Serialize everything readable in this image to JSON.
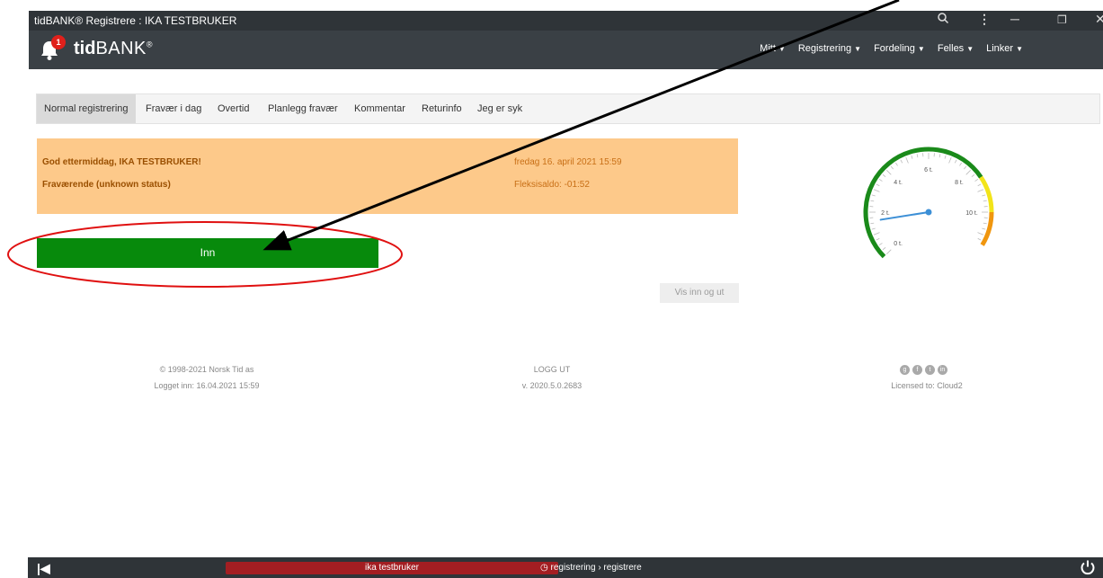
{
  "window": {
    "title": "tidBANK® Registrere : IKA TESTBRUKER",
    "controls": {
      "zoom_icon": "search-icon",
      "menu_icon": "kebab-icon",
      "minimize": "─",
      "restore": "❐",
      "close": "✕"
    }
  },
  "app": {
    "logo_bold": "tid",
    "logo_light": "BANK",
    "logo_mark": "®",
    "notification_count": "1",
    "nav": [
      {
        "label": "Mitt"
      },
      {
        "label": "Registrering"
      },
      {
        "label": "Fordeling"
      },
      {
        "label": "Felles"
      },
      {
        "label": "Linker"
      }
    ]
  },
  "tabs": [
    {
      "label": "Normal registrering",
      "active": true
    },
    {
      "label": "Fravær i dag"
    },
    {
      "label": "Overtid"
    },
    {
      "label": "Planlegg fravær"
    },
    {
      "label": "Kommentar"
    },
    {
      "label": "Returinfo"
    },
    {
      "label": "Jeg er syk"
    }
  ],
  "status": {
    "greeting": "God ettermiddag, IKA TESTBRUKER!",
    "state": "Fraværende (unknown status)",
    "datetime": "fredag 16. april 2021 15:59",
    "flex_balance": "Fleksisaldo: -01:52"
  },
  "buttons": {
    "inn": "Inn",
    "show_in_out": "Vis inn og ut"
  },
  "gauge": {
    "labels": [
      "0 t.",
      "2 t.",
      "4 t.",
      "6 t.",
      "8 t.",
      "10 t."
    ],
    "value_hours": 1.6,
    "colors": {
      "green": "#1a8a1a",
      "yellow": "#f2e41a",
      "orange": "#f0960e",
      "needle": "#3c8fd6"
    }
  },
  "footer": {
    "copyright": "© 1998-2021 Norsk Tid as",
    "logged_in": "Logget inn: 16.04.2021 15:59",
    "logout": "LOGG UT",
    "version": "v. 2020.5.0.2683",
    "licensed": "Licensed to: Cloud2",
    "social": [
      "google-plus-icon",
      "facebook-icon",
      "twitter-icon",
      "linkedin-icon"
    ]
  },
  "bottombar": {
    "user": "ika testbruker",
    "breadcrumb": "registrering › registrere",
    "power_icon": "power-icon"
  },
  "colors": {
    "titlebar": "#2f3438",
    "appbar": "#3a4045",
    "status_bg": "#fdc98a",
    "primary_green": "#078a0c",
    "user_red": "#a31e22",
    "annotation_red": "#e01010"
  }
}
